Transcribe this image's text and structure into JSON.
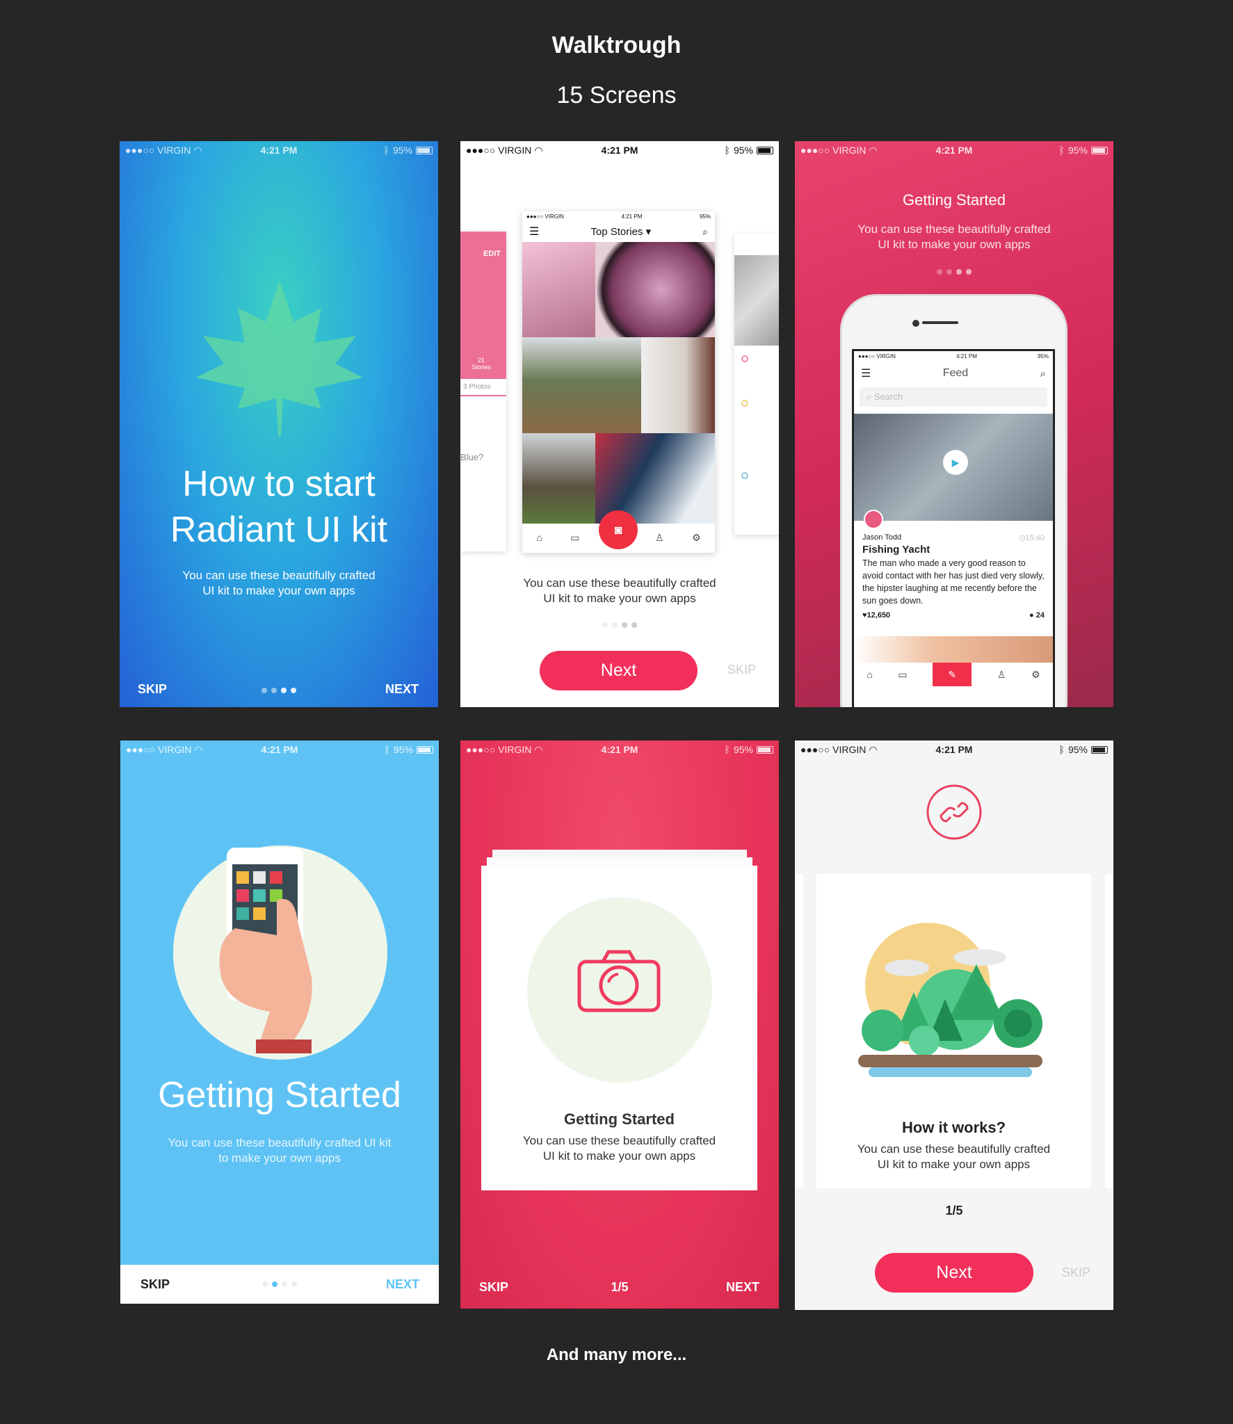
{
  "header": {
    "title": "Walktrough",
    "subtitle": "15 Screens"
  },
  "footer": {
    "text": "And many more..."
  },
  "status": {
    "carrier": "●●●○○ VIRGIN",
    "time": "4:21 PM",
    "battery": "95%"
  },
  "colors": {
    "accent": "#f2305b",
    "blue": "#5ec3f4",
    "red": "#ee3a5b",
    "background": "#262626"
  },
  "screen1": {
    "title_line1": "How to start",
    "title_line2": "Radiant UI kit",
    "subtitle_line1": "You can use these beautifully crafted",
    "subtitle_line2": "UI kit to make your own apps",
    "skip": "SKIP",
    "next": "NEXT",
    "dots": 4,
    "active_dot": 0
  },
  "screen2": {
    "mock_title": "Top Stories",
    "left_mock": {
      "edit": "EDIT",
      "stories_count": "21",
      "stories_label": "Stories",
      "photos": "3 Photos",
      "question": "Blue?"
    },
    "subtitle_line1": "You can use these beautifully crafted",
    "subtitle_line2": "UI kit to make your own apps",
    "next": "Next",
    "skip": "SKIP",
    "dots": 4,
    "active_dot": 0
  },
  "screen3": {
    "title": "Getting Started",
    "subtitle_line1": "You can use these beautifully crafted",
    "subtitle_line2": "UI kit to make your own apps",
    "feed": {
      "title": "Feed",
      "search_placeholder": "Search",
      "author": "Jason Todd",
      "time": "15:40",
      "post_title": "Fishing Yacht",
      "body": "The man who made a very good reason to avoid contact with her has just died very slowly, the hipster laughing at me recently before the sun goes down.",
      "likes": "12,650",
      "comments": "24"
    }
  },
  "screen4": {
    "title": "Getting Started",
    "subtitle_line1": "You can use these beautifully crafted UI kit",
    "subtitle_line2": "to make your own apps",
    "skip": "SKIP",
    "next": "NEXT",
    "dots": 4,
    "active_dot": 1
  },
  "screen5": {
    "title": "Getting Started",
    "subtitle_line1": "You can use these beautifully crafted",
    "subtitle_line2": "UI kit to make your own apps",
    "skip": "SKIP",
    "page": "1/5",
    "next": "NEXT"
  },
  "screen6": {
    "title": "How it works?",
    "subtitle_line1": "You can use these beautifully crafted",
    "subtitle_line2": "UI kit to make your own apps",
    "page": "1/5",
    "next": "Next",
    "skip": "SKIP"
  }
}
